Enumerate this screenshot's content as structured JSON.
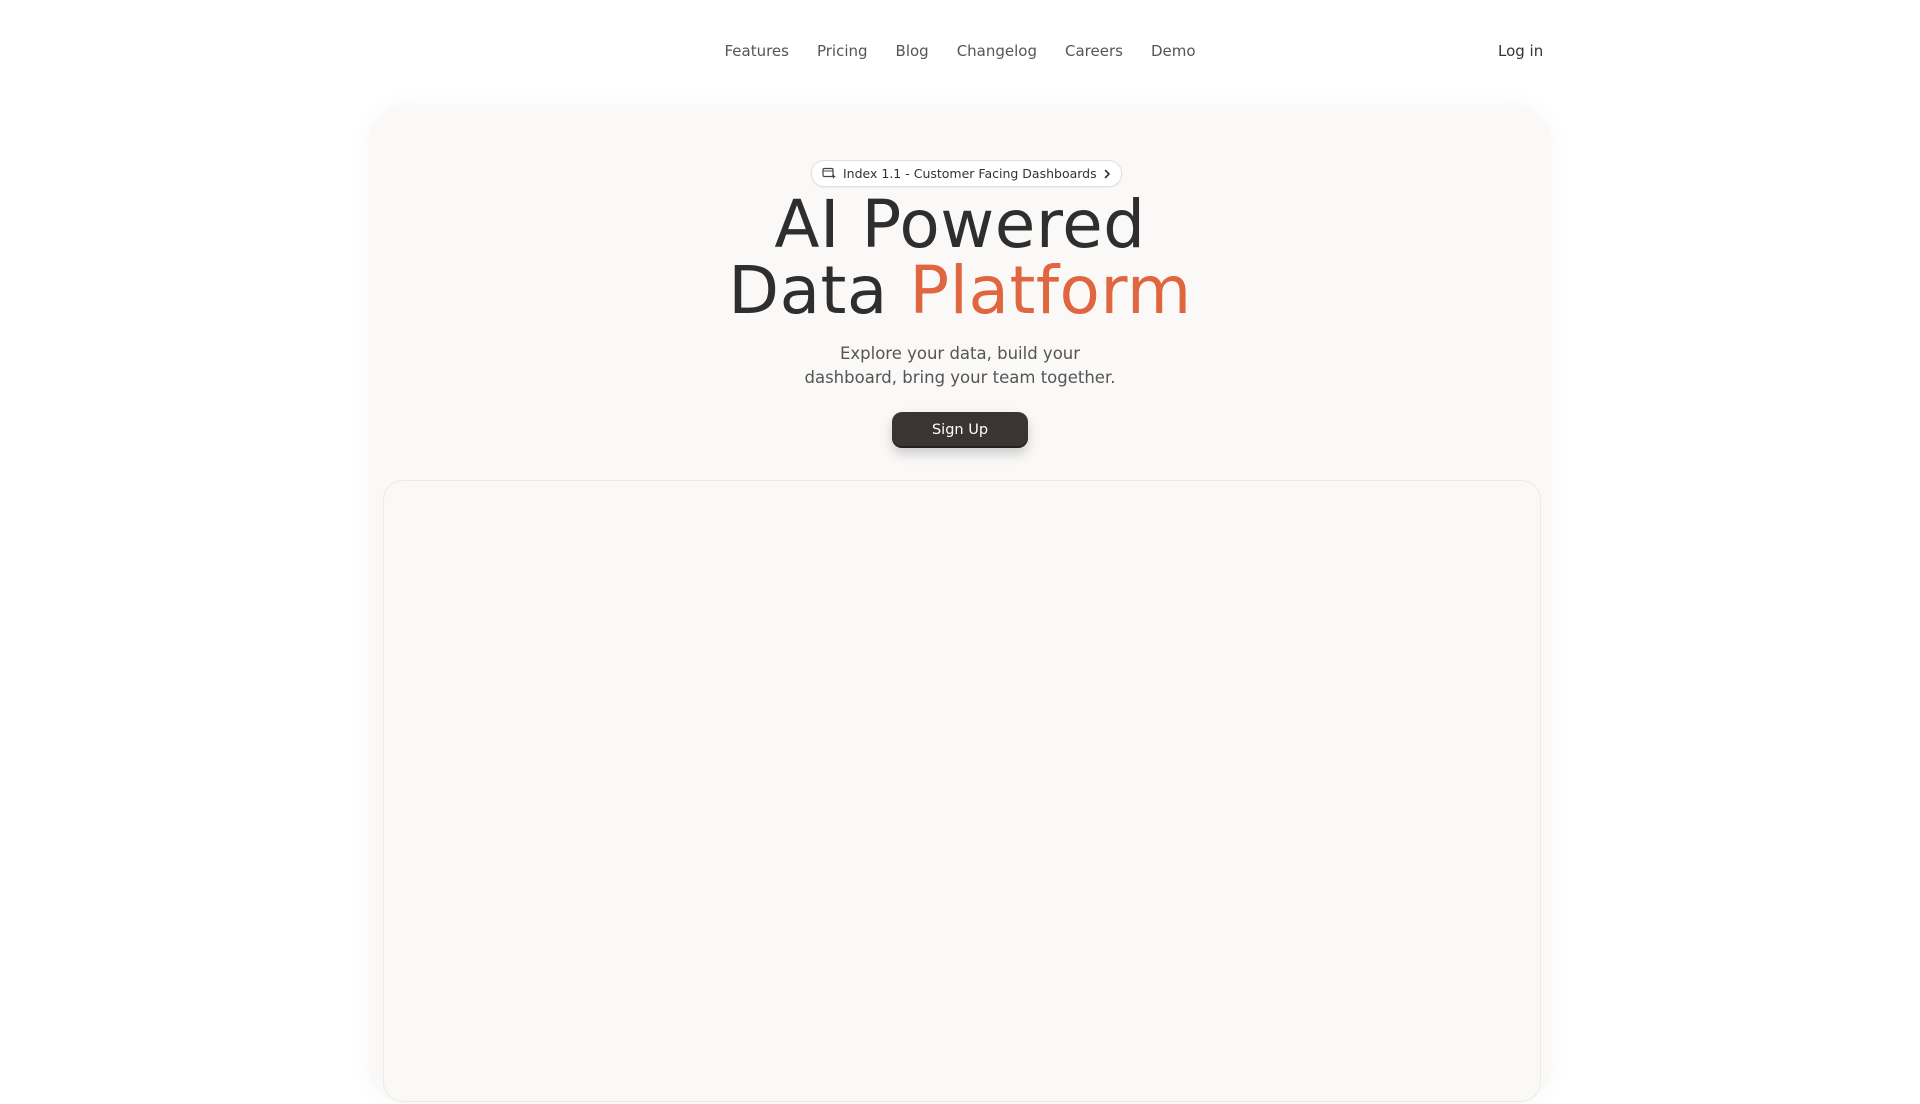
{
  "nav": {
    "links": [
      "Features",
      "Pricing",
      "Blog",
      "Changelog",
      "Careers",
      "Demo"
    ],
    "login_label": "Log in"
  },
  "hero": {
    "badge_text": "Index 1.1 - Customer Facing Dashboards",
    "badge_icon": "dashboard-sparkle-icon",
    "headline_line1": "AI Powered",
    "headline_line2_plain": "Data",
    "headline_line2_accent": "Platform",
    "subtitle_line1": "Explore your data, build your",
    "subtitle_line2": "dashboard, bring your team together.",
    "signup_label": "Sign Up"
  },
  "colors": {
    "accent": "#e0663f",
    "button": "#3a3432",
    "hero_bg": "#faf9f8"
  }
}
